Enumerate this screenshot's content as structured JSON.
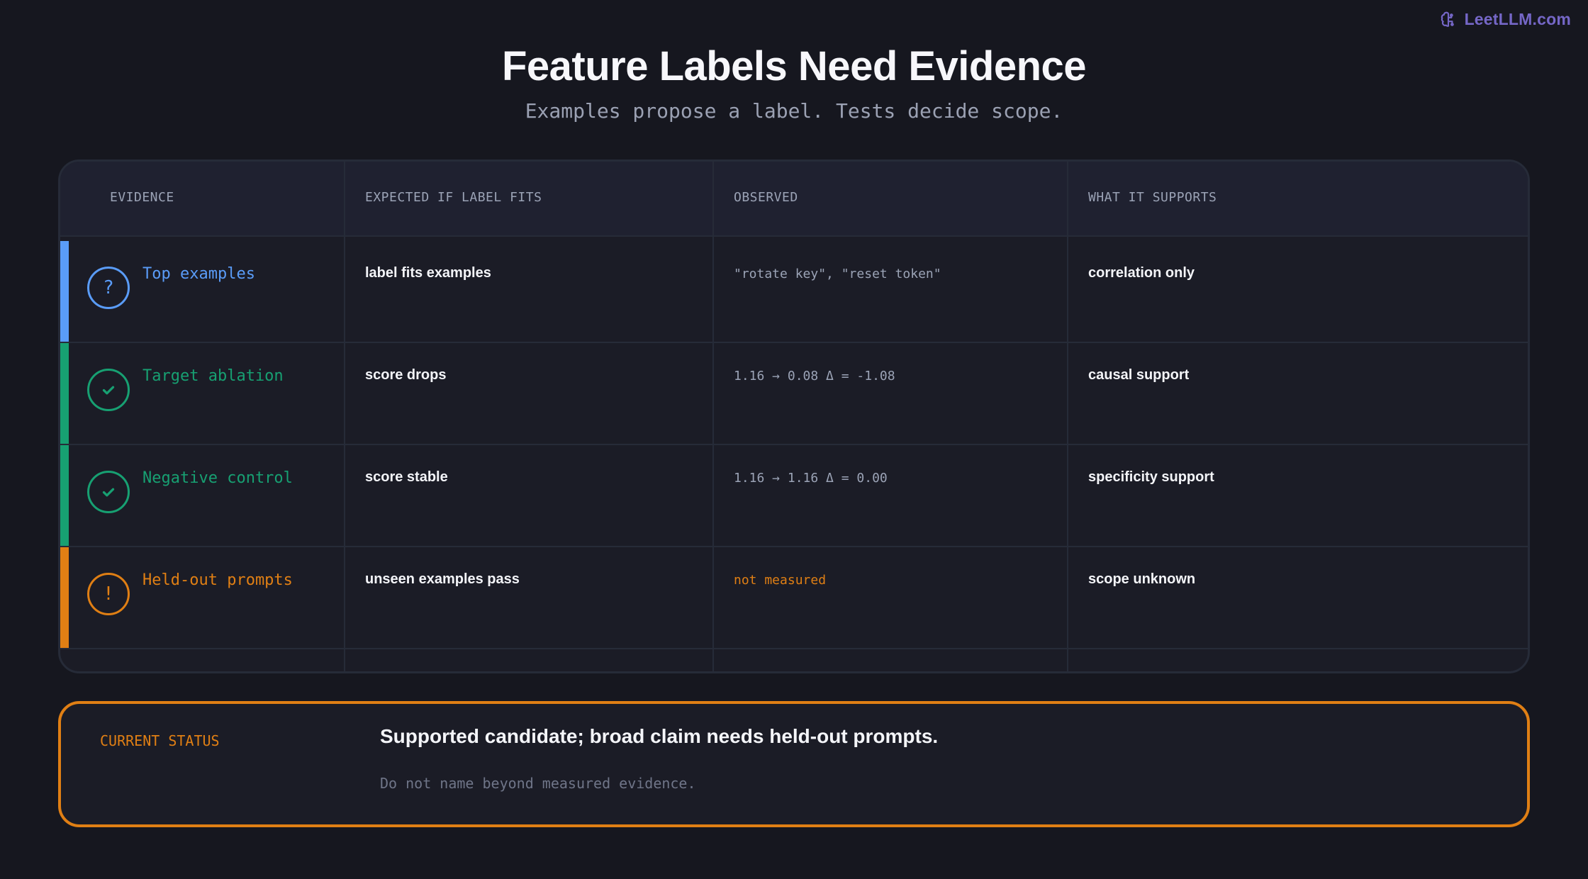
{
  "brand": {
    "name": "LeetLLM.com",
    "icon": "brain-icon"
  },
  "title": "Feature Labels Need Evidence",
  "subtitle": "Examples propose a label. Tests decide scope.",
  "table": {
    "headers": [
      "EVIDENCE",
      "EXPECTED IF LABEL FITS",
      "OBSERVED",
      "WHAT IT SUPPORTS"
    ],
    "rows": [
      {
        "evidence": "Top examples",
        "icon": "question-icon",
        "glyph": "?",
        "color": "#5a9cf8",
        "expected": "label fits examples",
        "observed": "\"rotate key\", \"reset token\"",
        "observed_color": "#9ba3b6",
        "supports": "correlation only"
      },
      {
        "evidence": "Target ablation",
        "icon": "check-icon",
        "glyph": "",
        "color": "#17a072",
        "expected": "score drops",
        "observed": "1.16 → 0.08 Δ = -1.08",
        "observed_color": "#9ba3b6",
        "supports": "causal support"
      },
      {
        "evidence": "Negative control",
        "icon": "check-icon",
        "glyph": "",
        "color": "#17a072",
        "expected": "score stable",
        "observed": "1.16 → 1.16 Δ = 0.00",
        "observed_color": "#9ba3b6",
        "supports": "specificity support"
      },
      {
        "evidence": "Held-out prompts",
        "icon": "exclamation-icon",
        "glyph": "!",
        "color": "#e07f14",
        "expected": "unseen examples pass",
        "observed": "not measured",
        "observed_color": "#e07f14",
        "supports": "scope unknown"
      }
    ]
  },
  "status": {
    "label": "CURRENT STATUS",
    "text": "Supported candidate; broad claim needs held-out prompts.",
    "note": "Do not name beyond measured evidence.",
    "color": "#e07f14"
  }
}
